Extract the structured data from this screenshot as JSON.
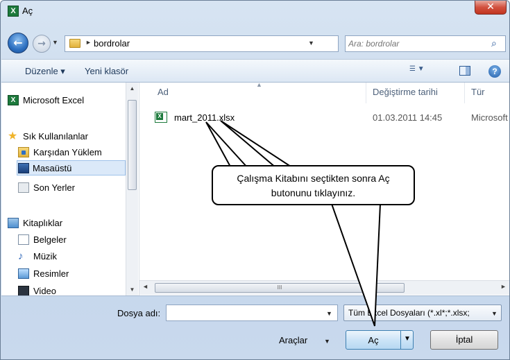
{
  "window": {
    "title": "Aç",
    "app_icon": "excel-icon",
    "close_glyph": "✕"
  },
  "nav": {
    "back_glyph": "←",
    "forward_glyph": "→",
    "address_path": "bordrolar",
    "refresh_glyph": "⇄",
    "search_placeholder": "Ara: bordrolar"
  },
  "toolbar": {
    "organize": "Düzenle ▾",
    "new_folder": "Yeni klasör",
    "help_glyph": "?"
  },
  "sidebar": {
    "items": [
      {
        "label": "Microsoft Excel",
        "icon": "excel-icon"
      },
      {
        "label": "Sık Kullanılanlar",
        "icon": "star-icon"
      },
      {
        "label": "Karşıdan Yüklem",
        "icon": "downloads-folder-icon"
      },
      {
        "label": "Masaüstü",
        "icon": "desktop-icon"
      },
      {
        "label": "Son Yerler",
        "icon": "recent-places-icon"
      },
      {
        "label": "Kitaplıklar",
        "icon": "libraries-icon"
      },
      {
        "label": "Belgeler",
        "icon": "documents-icon"
      },
      {
        "label": "Müzik",
        "icon": "music-icon"
      },
      {
        "label": "Resimler",
        "icon": "pictures-icon"
      },
      {
        "label": "Video",
        "icon": "video-icon"
      }
    ],
    "selected": "Masaüstü"
  },
  "filelist": {
    "columns": [
      "Ad",
      "Değiştirme tarihi",
      "Tür"
    ],
    "files": [
      {
        "name": "mart_2011.xlsx",
        "modified": "01.03.2011 14:45",
        "type": "Microsoft"
      }
    ],
    "hscroll_thumb": "III"
  },
  "bottom": {
    "filename_label": "Dosya adı:",
    "filename_value": "",
    "filter_value": "Tüm Excel Dosyaları (*.xl*;*.xlsx;",
    "tools_label": "Araçlar",
    "open_label": "Aç",
    "cancel_label": "İptal"
  },
  "callout": {
    "line1": "Çalışma Kitabını seçtikten sonra Aç",
    "line2": "butonunu tıklayınız."
  }
}
